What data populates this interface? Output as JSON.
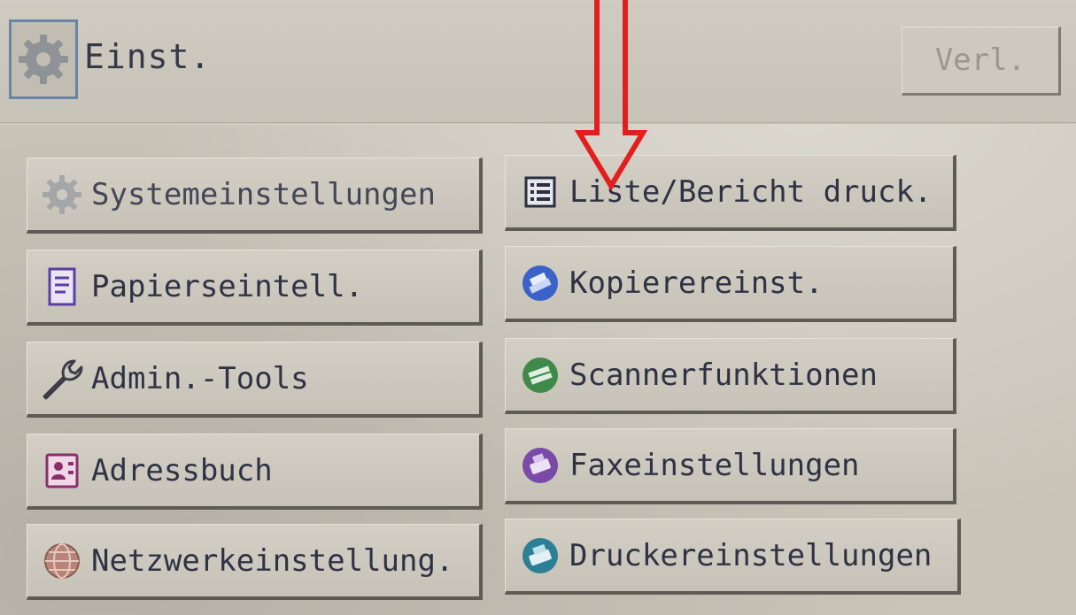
{
  "header": {
    "title": "Einst.",
    "exit_label": "Verl."
  },
  "menu": {
    "left": [
      {
        "label": "Systemeinstellungen",
        "icon": "gear-icon"
      },
      {
        "label": "Papierseintell.",
        "icon": "paper-icon"
      },
      {
        "label": "Admin.-Tools",
        "icon": "wrench-icon"
      },
      {
        "label": "Adressbuch",
        "icon": "address-book-icon"
      },
      {
        "label": "Netzwerkeinstellung.",
        "icon": "globe-icon"
      }
    ],
    "right": [
      {
        "label": "Liste/Bericht druck.",
        "icon": "list-icon"
      },
      {
        "label": "Kopierereinst.",
        "icon": "copier-icon"
      },
      {
        "label": "Scannerfunktionen",
        "icon": "scanner-icon"
      },
      {
        "label": "Faxeinstellungen",
        "icon": "fax-icon"
      },
      {
        "label": "Druckereinstellungen",
        "icon": "printer-icon"
      }
    ]
  },
  "colors": {
    "annotation_arrow": "#e31e1e",
    "button_text": "#2e3244",
    "copier_icon": "#3a63c8",
    "scanner_icon": "#3f8a4a",
    "fax_icon": "#7a4aa8",
    "printer_icon": "#2d7f96"
  }
}
